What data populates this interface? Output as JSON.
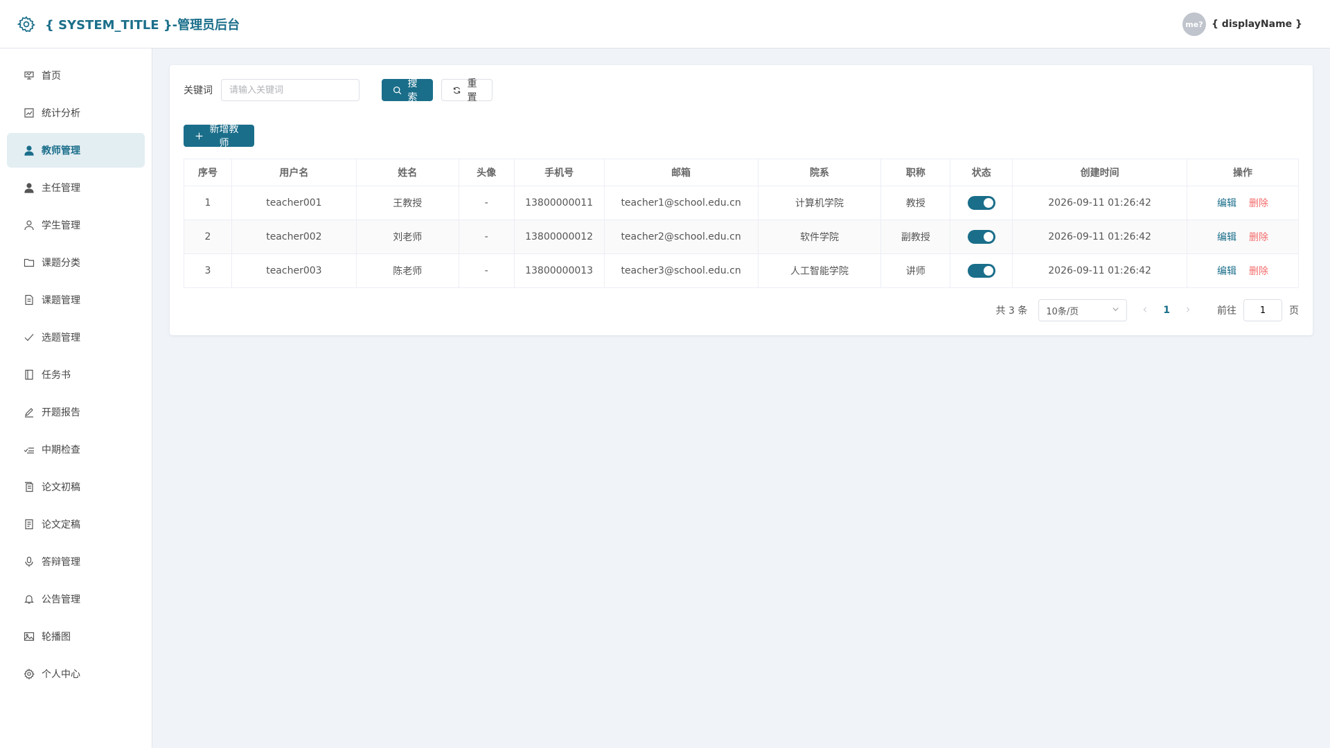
{
  "header": {
    "title": "{ SYSTEM_TITLE }-管理员后台",
    "user_name": "{ displayName }",
    "avatar_text": "me?"
  },
  "sidebar": {
    "items": [
      {
        "label": "首页",
        "icon": "dashboard-icon"
      },
      {
        "label": "统计分析",
        "icon": "chart-icon"
      },
      {
        "label": "教师管理",
        "icon": "user-icon",
        "active": true
      },
      {
        "label": "主任管理",
        "icon": "user-icon"
      },
      {
        "label": "学生管理",
        "icon": "user-outline-icon"
      },
      {
        "label": "课题分类",
        "icon": "folder-icon"
      },
      {
        "label": "课题管理",
        "icon": "document-icon"
      },
      {
        "label": "选题管理",
        "icon": "check-icon"
      },
      {
        "label": "任务书",
        "icon": "notebook-icon"
      },
      {
        "label": "开题报告",
        "icon": "edit-pen-icon"
      },
      {
        "label": "中期检查",
        "icon": "finished-icon"
      },
      {
        "label": "论文初稿",
        "icon": "document-copy-icon"
      },
      {
        "label": "论文定稿",
        "icon": "tickets-icon"
      },
      {
        "label": "答辩管理",
        "icon": "microphone-icon"
      },
      {
        "label": "公告管理",
        "icon": "bell-icon"
      },
      {
        "label": "轮播图",
        "icon": "picture-icon"
      },
      {
        "label": "个人中心",
        "icon": "settings-icon"
      }
    ]
  },
  "search": {
    "label": "关键词",
    "placeholder": "请输入关键词",
    "value": "",
    "search_label": "搜索",
    "reset_label": "重置"
  },
  "toolbar": {
    "add_label": "新增教师"
  },
  "table": {
    "columns": [
      "序号",
      "用户名",
      "姓名",
      "头像",
      "手机号",
      "邮箱",
      "院系",
      "职称",
      "状态",
      "创建时间",
      "操作"
    ],
    "rows": [
      {
        "index": "1",
        "username": "teacher001",
        "name": "王教授",
        "avatar": "-",
        "phone": "13800000011",
        "email": "teacher1@school.edu.cn",
        "dept": "计算机学院",
        "title": "教授",
        "enabled": true,
        "created": "2026-09-11 01:26:42"
      },
      {
        "index": "2",
        "username": "teacher002",
        "name": "刘老师",
        "avatar": "-",
        "phone": "13800000012",
        "email": "teacher2@school.edu.cn",
        "dept": "软件学院",
        "title": "副教授",
        "enabled": true,
        "created": "2026-09-11 01:26:42"
      },
      {
        "index": "3",
        "username": "teacher003",
        "name": "陈老师",
        "avatar": "-",
        "phone": "13800000013",
        "email": "teacher3@school.edu.cn",
        "dept": "人工智能学院",
        "title": "讲师",
        "enabled": true,
        "created": "2026-09-11 01:26:42"
      }
    ],
    "edit_label": "编辑",
    "delete_label": "删除"
  },
  "pagination": {
    "total_text": "共 3 条",
    "page_size": "10条/页",
    "current_page": "1",
    "goto_label": "前往",
    "goto_value": "1",
    "page_suffix": "页"
  },
  "colors": {
    "primary": "#1a6e8a",
    "danger": "#f56c6c",
    "background": "#f0f4f8"
  }
}
